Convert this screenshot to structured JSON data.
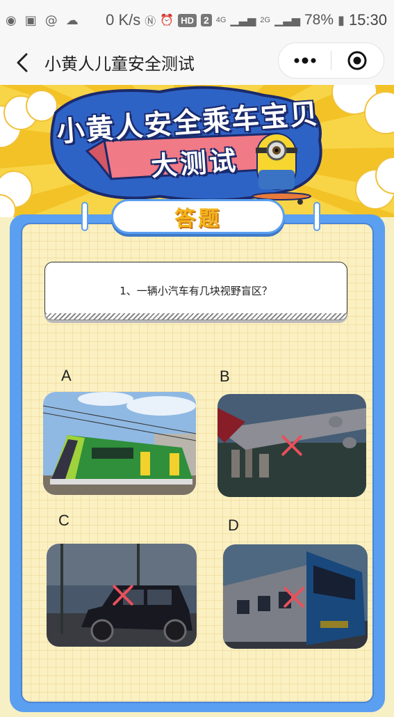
{
  "status_bar": {
    "net_speed": "0 K/s",
    "hd_badge": "HD",
    "sim_badge": "2",
    "network_4g": "4G",
    "network_2g": "2G",
    "battery": "78%",
    "time": "15:30",
    "icons": [
      "weibo-icon",
      "gallery-icon",
      "email-icon",
      "weather-icon",
      "nfc-icon",
      "alarm-icon",
      "signal-icon",
      "battery-icon"
    ]
  },
  "nav": {
    "title": "小黄人儿童安全测试"
  },
  "hero": {
    "title": "小黄人安全乘车宝贝",
    "subtitle": "大测试"
  },
  "section_tag": "答题",
  "question": {
    "text": "1、一辆小汽车有几块视野盲区？"
  },
  "options": [
    {
      "letter": "A",
      "image": "tram-photo",
      "state": "normal"
    },
    {
      "letter": "B",
      "image": "airplane-photo",
      "state": "wrong"
    },
    {
      "letter": "C",
      "image": "vintage-car-photo",
      "state": "wrong"
    },
    {
      "letter": "D",
      "image": "train-photo",
      "state": "wrong"
    }
  ],
  "colors": {
    "hero_yellow": "#f8d547",
    "board_blue": "#5b9ff0",
    "paper": "#fbf0c1",
    "wrong_mark": "#e8505b",
    "tag_text": "#f3b51c"
  }
}
